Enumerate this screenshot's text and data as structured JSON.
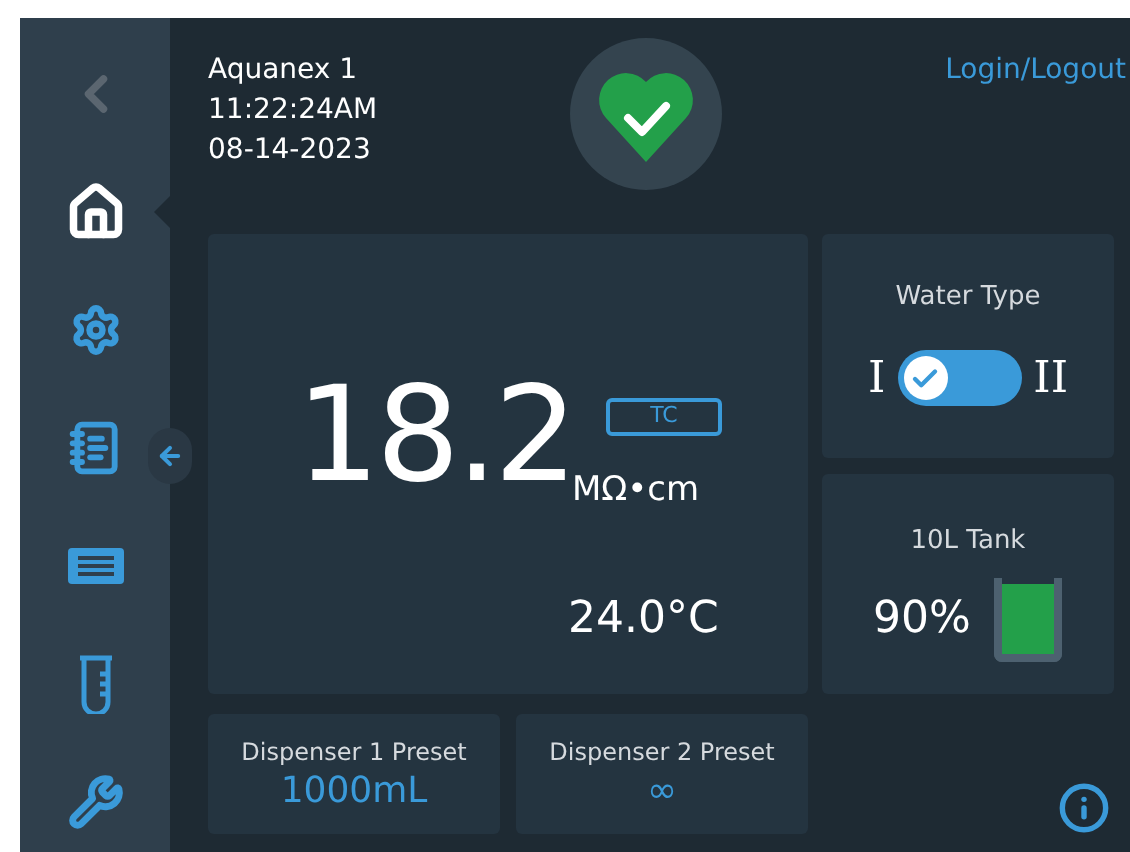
{
  "sidebar": {
    "items": [
      {
        "kind": "back",
        "selected": false
      },
      {
        "kind": "home",
        "selected": true
      },
      {
        "kind": "settings",
        "selected": false
      },
      {
        "kind": "log",
        "selected": false
      },
      {
        "kind": "panel",
        "selected": false
      },
      {
        "kind": "tube",
        "selected": false
      },
      {
        "kind": "tools",
        "selected": false
      }
    ]
  },
  "header": {
    "device": "Aquanex 1",
    "time": "11:22:24AM",
    "date": "08-14-2023",
    "healthy": true,
    "login": "Login/Logout"
  },
  "reading": {
    "value": "18.2",
    "unit": "MΩ•cm",
    "badge": "TC",
    "temperature": "24.0°C"
  },
  "water_type": {
    "title": "Water Type",
    "left": "I",
    "right": "II",
    "on": false
  },
  "tank": {
    "title": "10L Tank",
    "percent": "90%"
  },
  "dispensers": [
    {
      "label": "Dispenser 1 Preset",
      "value": "1000mL"
    },
    {
      "label": "Dispenser 2 Preset",
      "value": "∞"
    }
  ]
}
